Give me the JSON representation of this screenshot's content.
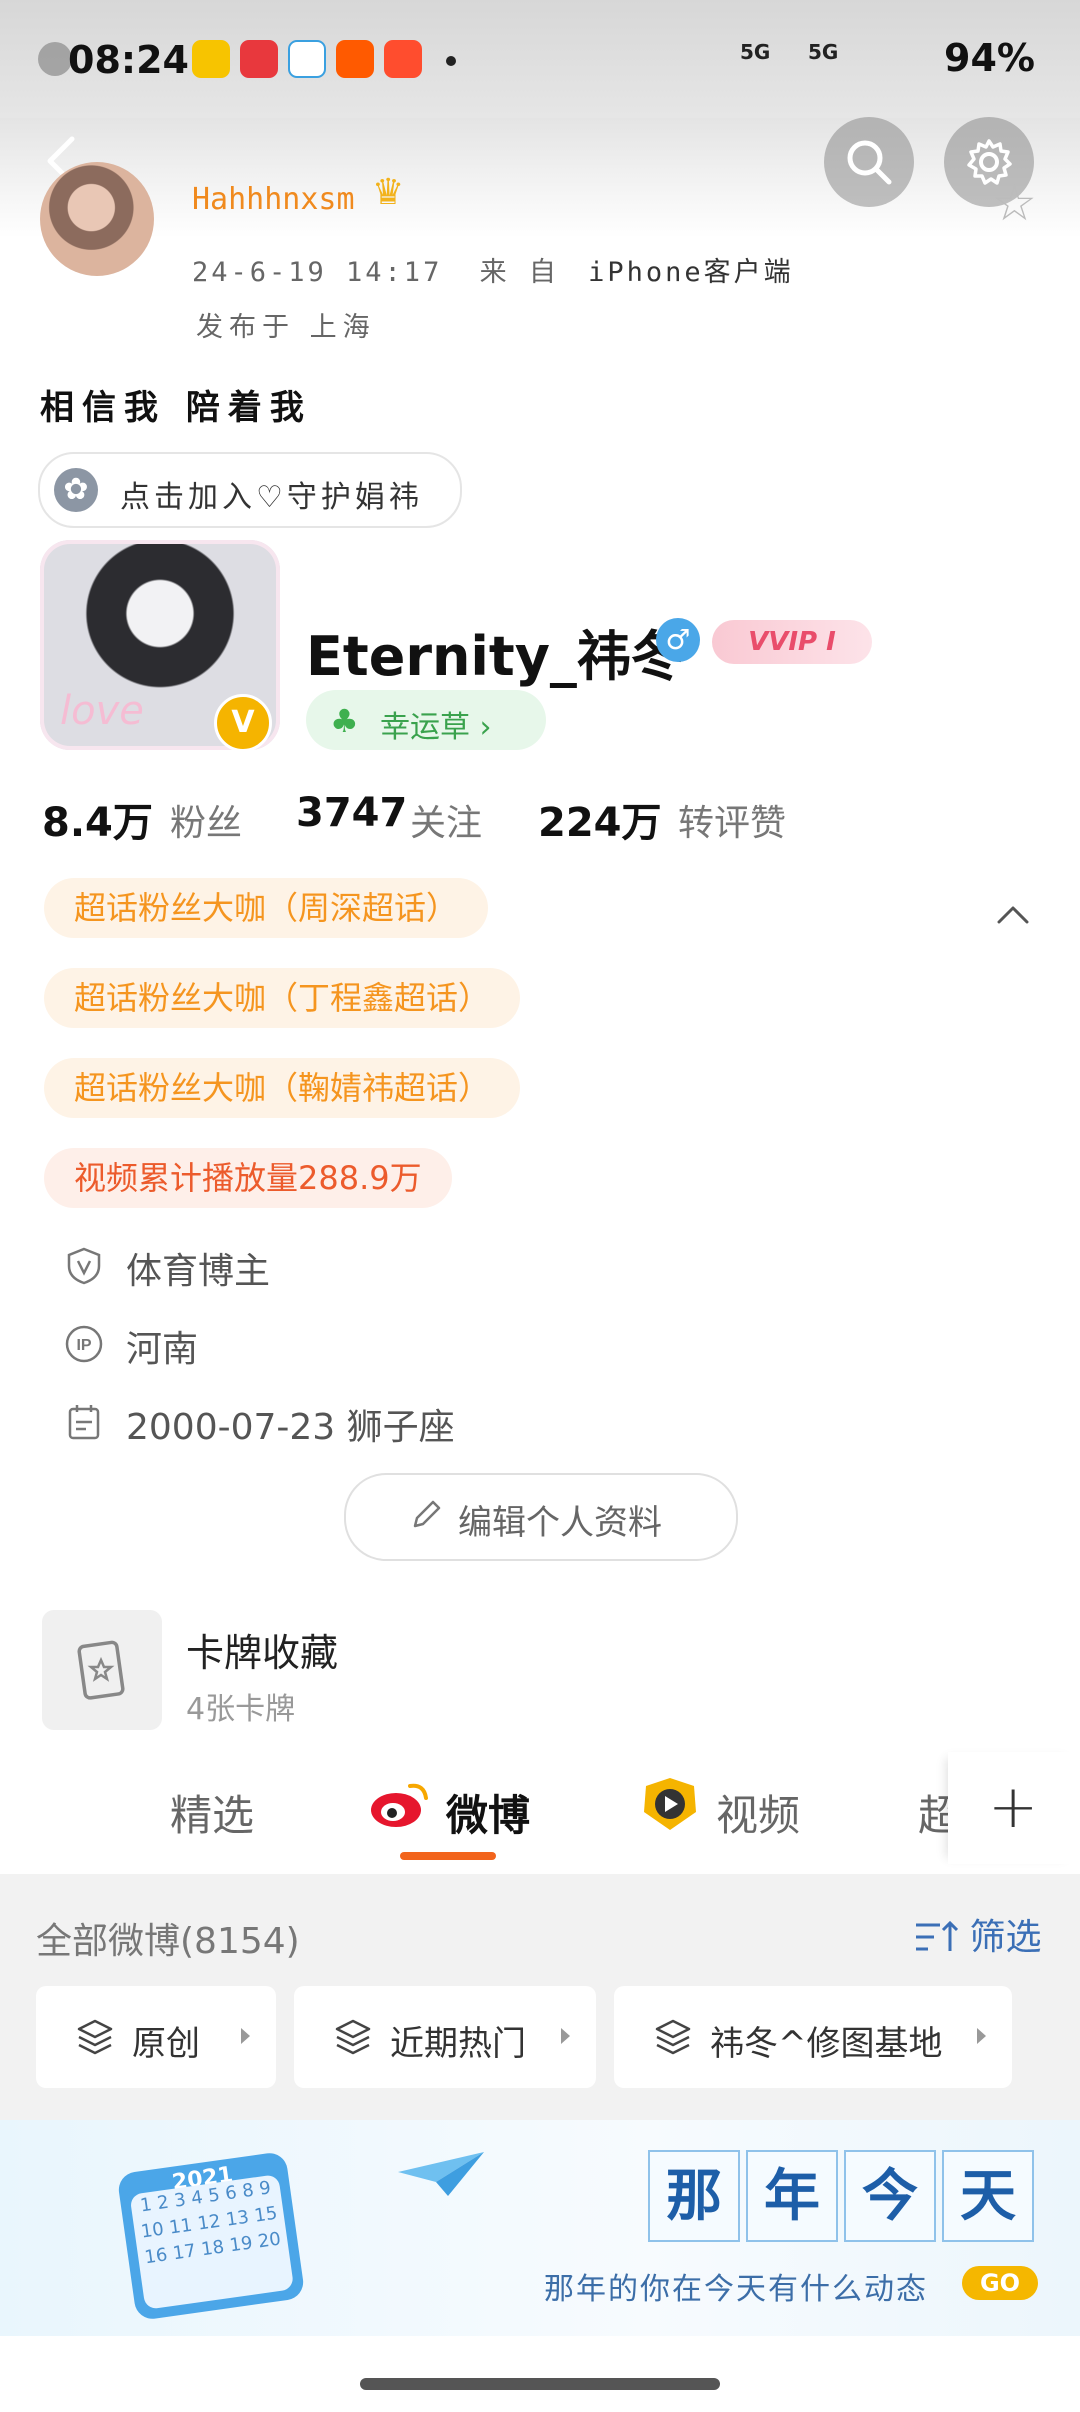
{
  "status_bar": {
    "time": "08:24",
    "battery": "94%",
    "network_1": "5G",
    "network_2": "5G",
    "app_icons": [
      "weibo-icon",
      "news-icon",
      "mobile-icon",
      "taobao-icon",
      "app-icon"
    ]
  },
  "header": {
    "back_icon": "chevron-left-icon",
    "search_icon": "search-icon",
    "settings_icon": "gear-icon",
    "star_icon": "star-icon"
  },
  "post": {
    "author": "Hahhhnxsm",
    "time": "24-6-19 14:17",
    "from_prefix": "来 自",
    "source": "iPhone客户端",
    "location": "发布于 上海",
    "text": "相信我 陪着我",
    "join_label": "点击加入♡守护娟祎"
  },
  "profile": {
    "name": "Eternity_祎冬",
    "gender_symbol": "♂",
    "vip_label": "VVIP I",
    "verified_symbol": "V",
    "clover_label": "幸运草 ›",
    "avatar_text": "love",
    "stats": [
      {
        "num": "8.4万",
        "label": "粉丝"
      },
      {
        "num": "3747",
        "label": "关注"
      },
      {
        "num": "224万",
        "label": "转评赞"
      }
    ],
    "tags": [
      "超话粉丝大咖（周深超话）",
      "超话粉丝大咖（丁程鑫超话）",
      "超话粉丝大咖（鞠婧祎超话）",
      "视频累计播放量288.9万"
    ],
    "info": [
      {
        "icon": "v-shield-icon",
        "text": "体育博主"
      },
      {
        "icon": "ip-icon",
        "text": "河南"
      },
      {
        "icon": "calendar-icon",
        "text": "2000-07-23 狮子座"
      }
    ],
    "edit_label": "编辑个人资料"
  },
  "card_collection": {
    "title": "卡牌收藏",
    "subtitle": "4张卡牌"
  },
  "tabs": [
    "精选",
    "微博",
    "视频",
    "超"
  ],
  "active_tab": "微博",
  "filter": {
    "all_count": "全部微博(8154)",
    "filter_label": "筛选",
    "chips": [
      "原创",
      "近期热门",
      "祎冬^修图基地"
    ]
  },
  "banner": {
    "calendar_year": "2021",
    "calendar_days": "1 2 3 4 5 6 8 9 10 11 12 13 15 16 17 18 19 20",
    "title_chars": [
      "那",
      "年",
      "今",
      "天"
    ],
    "subtitle": "那年的你在今天有什么动态",
    "go_label": "GO"
  },
  "colors": {
    "accent": "#f2641c",
    "tag_text": "#f5951f",
    "link_blue": "#3b6fb6",
    "clover_green": "#3aa24d"
  }
}
